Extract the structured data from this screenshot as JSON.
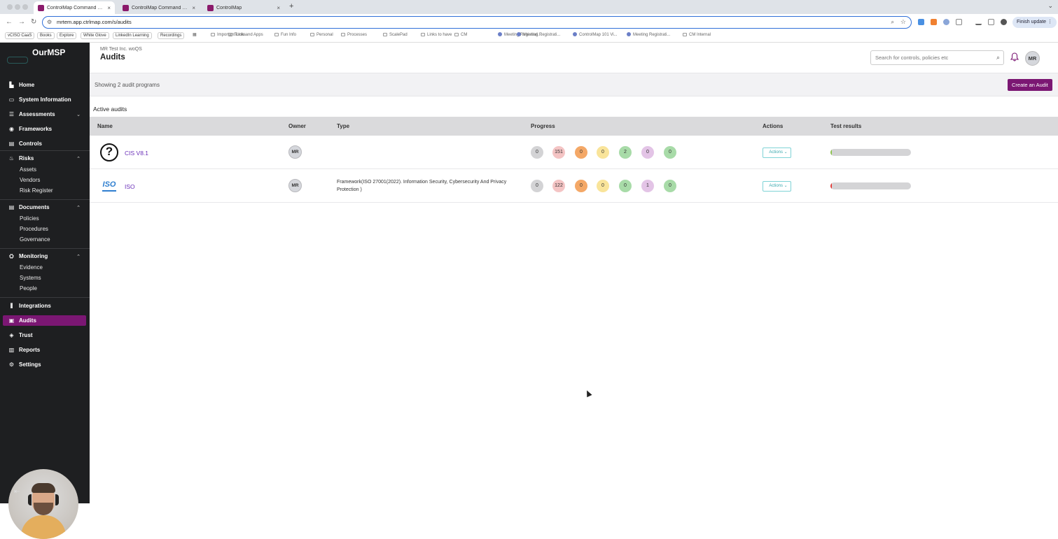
{
  "browser": {
    "tabs": [
      {
        "title": "ControlMap Command Center",
        "close": "×"
      },
      {
        "title": "ControlMap Command Center",
        "close": "×"
      },
      {
        "title": "ControlMap",
        "close": "×"
      }
    ],
    "new_tab": "+",
    "url": "mrtem.app.ctrlmap.com/s/audits",
    "finish_update": "Finish update",
    "bookmarks": [
      {
        "label": "vCISO CaaS",
        "kind": "tag"
      },
      {
        "label": "Books",
        "kind": "tag"
      },
      {
        "label": "Explore",
        "kind": "tag"
      },
      {
        "label": "White Glove",
        "kind": "tag"
      },
      {
        "label": "LinkedIn Learning",
        "kind": "tag"
      },
      {
        "label": "Recordings",
        "kind": "tag"
      },
      {
        "label": "Important Links",
        "kind": "folder"
      },
      {
        "label": "Tools and Apps",
        "kind": "folder"
      },
      {
        "label": "Fun Info",
        "kind": "folder"
      },
      {
        "label": "Personal",
        "kind": "folder"
      },
      {
        "label": "Processes",
        "kind": "folder"
      },
      {
        "label": "ScalePad",
        "kind": "folder"
      },
      {
        "label": "Links to have",
        "kind": "folder"
      },
      {
        "label": "CM",
        "kind": "folder"
      },
      {
        "label": "Meeting Registrati...",
        "kind": "site"
      },
      {
        "label": "Meeting Registrati...",
        "kind": "site"
      },
      {
        "label": "ControlMap 101 Vi...",
        "kind": "site"
      },
      {
        "label": "Meeting Registrati...",
        "kind": "site"
      },
      {
        "label": "CM Internal",
        "kind": "folder"
      }
    ]
  },
  "sidebar": {
    "brand": "OurMSP",
    "items": [
      {
        "label": "Home",
        "icon": "home-icon",
        "glyph": "▙"
      },
      {
        "label": "System Information",
        "icon": "info-icon",
        "glyph": "▭"
      },
      {
        "label": "Assessments",
        "icon": "list-icon",
        "glyph": "☰",
        "caret": "⌄"
      },
      {
        "label": "Frameworks",
        "icon": "framework-icon",
        "glyph": "◉"
      },
      {
        "label": "Controls",
        "icon": "controls-icon",
        "glyph": "▤"
      },
      {
        "label": "Risks",
        "icon": "flame-icon",
        "glyph": "♨",
        "caret": "⌃"
      },
      {
        "label": "Documents",
        "icon": "document-icon",
        "glyph": "▤",
        "caret": "⌃"
      },
      {
        "label": "Monitoring",
        "icon": "monitoring-icon",
        "glyph": "⛭",
        "caret": "⌃"
      },
      {
        "label": "Integrations",
        "icon": "integrations-icon",
        "glyph": "⫼"
      },
      {
        "label": "Audits",
        "icon": "audit-icon",
        "glyph": "▣"
      },
      {
        "label": "Trust",
        "icon": "trust-icon",
        "glyph": "◈"
      },
      {
        "label": "Reports",
        "icon": "reports-icon",
        "glyph": "▥"
      },
      {
        "label": "Settings",
        "icon": "gear-icon",
        "glyph": "⚙"
      }
    ],
    "risks_sub": [
      "Assets",
      "Vendors",
      "Risk Register"
    ],
    "documents_sub": [
      "Policies",
      "Procedures",
      "Governance"
    ],
    "monitoring_sub": [
      "Evidence",
      "Systems",
      "People"
    ],
    "collapse_glyph": "⇤"
  },
  "header": {
    "org": "MR Test Inc. woQS",
    "title": "Audits",
    "search_placeholder": "Search for controls, policies etc",
    "avatar": "MR"
  },
  "subbar": {
    "showing": "Showing 2 audit programs",
    "create_button": "Create an Audit"
  },
  "table": {
    "section_title": "Active audits",
    "columns": [
      "Name",
      "Owner",
      "Type",
      "Progress",
      "Actions",
      "Test results"
    ],
    "rows": [
      {
        "name": "CIS V8.1",
        "icon": "question-icon",
        "icon_text": "?",
        "owner": "MR",
        "type": "",
        "progress": [
          "0",
          "151",
          "0",
          "0",
          "2",
          "0",
          "0"
        ],
        "actions": "Actions ⌄",
        "test_result_pct": 2,
        "test_result_color": "#8bc34a"
      },
      {
        "name": "ISO",
        "icon": "iso-icon",
        "icon_text": "ISO",
        "owner": "MR",
        "type": "Framework(ISO 27001(2022). Information Security, Cybersecurity And Privacy Protection )",
        "progress": [
          "0",
          "122",
          "0",
          "0",
          "0",
          "1",
          "0"
        ],
        "actions": "Actions ⌄",
        "test_result_pct": 2,
        "test_result_color": "#e53935"
      }
    ],
    "progress_colors": [
      "#d3d3d5",
      "#f4c4c4",
      "#f4a867",
      "#f9e49a",
      "#a8dba8",
      "#e3c4e6",
      "#a8dba8"
    ]
  }
}
